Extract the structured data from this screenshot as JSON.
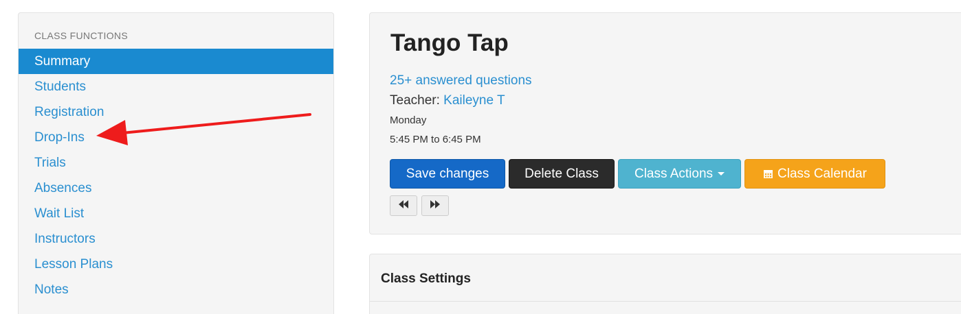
{
  "sidebar": {
    "heading": "CLASS FUNCTIONS",
    "active_index": 0,
    "items": [
      {
        "label": "Summary"
      },
      {
        "label": "Students"
      },
      {
        "label": "Registration"
      },
      {
        "label": "Drop-Ins"
      },
      {
        "label": "Trials"
      },
      {
        "label": "Absences"
      },
      {
        "label": "Wait List"
      },
      {
        "label": "Instructors"
      },
      {
        "label": "Lesson Plans"
      },
      {
        "label": "Notes"
      }
    ]
  },
  "annotation": {
    "type": "arrow-icon",
    "points_to": "Drop-Ins",
    "color": "#ee1c1c"
  },
  "class_panel": {
    "title": "Tango Tap",
    "answered_link": "25+ answered questions",
    "teacher_label": "Teacher:",
    "teacher_name": "Kaileyne T",
    "day": "Monday",
    "time": "5:45 PM to 6:45 PM",
    "buttons": {
      "save": "Save changes",
      "delete": "Delete Class",
      "actions": "Class Actions",
      "calendar": "Class Calendar"
    },
    "nav_icons": {
      "prev": "fast-backward-icon",
      "next": "fast-forward-icon"
    }
  },
  "settings_panel": {
    "title": "Class Settings"
  },
  "colors": {
    "link": "#2a8fd0",
    "active_nav": "#1a8ad0",
    "save": "#1569c7",
    "delete": "#2b2b2b",
    "actions": "#4fb3cf",
    "calendar": "#f5a31a"
  }
}
